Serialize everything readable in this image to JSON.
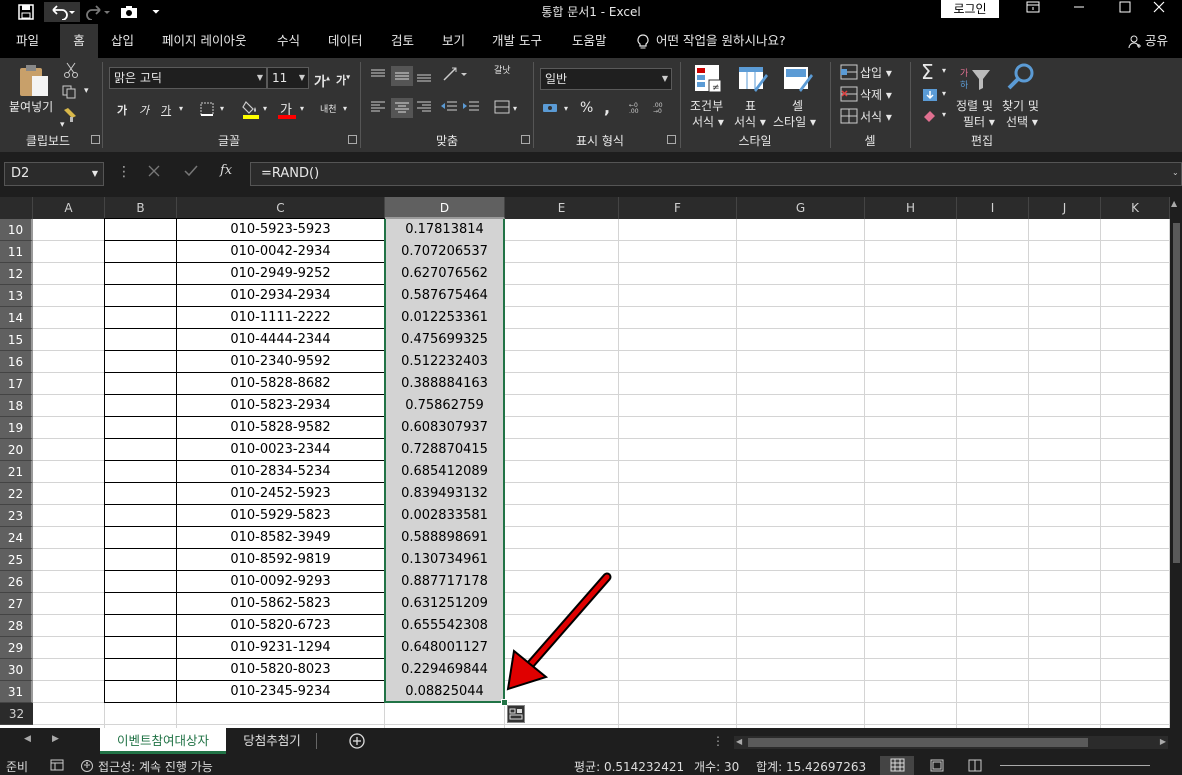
{
  "window": {
    "title": "통합 문서1 - Excel",
    "login_label": "로그인",
    "qa_save": "save-icon",
    "qa_undo": "undo-icon",
    "qa_redo": "redo-icon",
    "qa_camera": "camera-icon"
  },
  "tabs": {
    "file": "파일",
    "home": "홈",
    "insert": "삽입",
    "page_layout": "페이지 레이아웃",
    "formulas": "수식",
    "data": "데이터",
    "review": "검토",
    "view": "보기",
    "developer": "개발 도구",
    "help": "도움말",
    "tell_me": "어떤 작업을 원하시나요?",
    "share": "공유"
  },
  "ribbon": {
    "clipboard": {
      "paste": "붙여넣기",
      "label": "클립보드"
    },
    "font": {
      "name": "맑은 고딕",
      "size": "11",
      "label": "글꼴",
      "bold": "가",
      "italic": "가",
      "underline": "가",
      "grow": "가",
      "shrink": "가",
      "color_a": "가",
      "phonetic": "내천"
    },
    "alignment": {
      "label": "맞춤",
      "wrap": "갈낫"
    },
    "number": {
      "format": "일반",
      "label": "표시 형식",
      "percent": "%",
      "comma": ","
    },
    "styles": {
      "conditional_1": "조건부",
      "conditional_2": "서식",
      "table_1": "표",
      "table_2": "서식",
      "cell_1": "셀",
      "cell_2": "스타일",
      "label": "스타일"
    },
    "cells": {
      "insert": "삽입",
      "delete": "삭제",
      "format": "서식",
      "label": "셀"
    },
    "editing": {
      "sort_1": "정렬 및",
      "sort_2": "필터",
      "find_1": "찾기 및",
      "find_2": "선택",
      "label": "편집"
    }
  },
  "formula_bar": {
    "name_box": "D2",
    "fx": "fx",
    "formula": "=RAND()"
  },
  "columns": [
    "A",
    "B",
    "C",
    "D",
    "E",
    "F",
    "G",
    "H",
    "I",
    "J",
    "K"
  ],
  "rows": [
    {
      "n": "10",
      "phone": "010-5923-5923",
      "rand": "0.17813814"
    },
    {
      "n": "11",
      "phone": "010-0042-2934",
      "rand": "0.707206537"
    },
    {
      "n": "12",
      "phone": "010-2949-9252",
      "rand": "0.627076562"
    },
    {
      "n": "13",
      "phone": "010-2934-2934",
      "rand": "0.587675464"
    },
    {
      "n": "14",
      "phone": "010-1111-2222",
      "rand": "0.012253361"
    },
    {
      "n": "15",
      "phone": "010-4444-2344",
      "rand": "0.475699325"
    },
    {
      "n": "16",
      "phone": "010-2340-9592",
      "rand": "0.512232403"
    },
    {
      "n": "17",
      "phone": "010-5828-8682",
      "rand": "0.388884163"
    },
    {
      "n": "18",
      "phone": "010-5823-2934",
      "rand": "0.75862759"
    },
    {
      "n": "19",
      "phone": "010-5828-9582",
      "rand": "0.608307937"
    },
    {
      "n": "20",
      "phone": "010-0023-2344",
      "rand": "0.728870415"
    },
    {
      "n": "21",
      "phone": "010-2834-5234",
      "rand": "0.685412089"
    },
    {
      "n": "22",
      "phone": "010-2452-5923",
      "rand": "0.839493132"
    },
    {
      "n": "23",
      "phone": "010-5929-5823",
      "rand": "0.002833581"
    },
    {
      "n": "24",
      "phone": "010-8582-3949",
      "rand": "0.588898691"
    },
    {
      "n": "25",
      "phone": "010-8592-9819",
      "rand": "0.130734961"
    },
    {
      "n": "26",
      "phone": "010-0092-9293",
      "rand": "0.887717178"
    },
    {
      "n": "27",
      "phone": "010-5862-5823",
      "rand": "0.631251209"
    },
    {
      "n": "28",
      "phone": "010-5820-6723",
      "rand": "0.655542308"
    },
    {
      "n": "29",
      "phone": "010-9231-1294",
      "rand": "0.648001127"
    },
    {
      "n": "30",
      "phone": "010-5820-8023",
      "rand": "0.229469844"
    },
    {
      "n": "31",
      "phone": "010-2345-9234",
      "rand": "0.08825044"
    },
    {
      "n": "32",
      "phone": "",
      "rand": ""
    }
  ],
  "sheets": {
    "active": "이벤트참여대상자",
    "other": "당첨추첨기"
  },
  "status": {
    "ready": "준비",
    "accessibility": "접근성: 계속 진행 가능",
    "average": "평균: 0.514232421",
    "count": "개수: 30",
    "sum": "합계: 15.42697263"
  },
  "colors": {
    "selection_border": "#217346",
    "arrow": "#e00000"
  }
}
